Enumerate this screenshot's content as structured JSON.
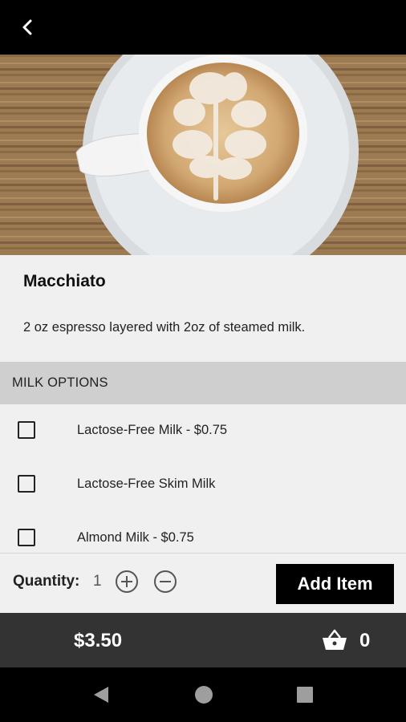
{
  "product": {
    "name": "Macchiato",
    "description": "2 oz espresso layered with 2oz of steamed milk."
  },
  "milk_options": {
    "header": "MILK OPTIONS",
    "items": [
      {
        "label": "Lactose-Free Milk - $0.75",
        "checked": false
      },
      {
        "label": "Lactose-Free Skim Milk",
        "checked": false
      },
      {
        "label": "Almond Milk - $0.75",
        "checked": false
      }
    ]
  },
  "quantity": {
    "label": "Quantity:",
    "value": "1"
  },
  "add_item_label": "Add Item",
  "cart": {
    "total": "$3.50",
    "count": "0"
  },
  "icons": {
    "back": "chevron-left-icon",
    "increment": "plus-circle-icon",
    "decrement": "minus-circle-icon",
    "cart": "shopping-basket-icon",
    "nav_back": "triangle-back-icon",
    "nav_home": "circle-home-icon",
    "nav_recents": "square-recents-icon"
  },
  "colors": {
    "top_bar": "#000000",
    "section_header": "#cfcfcf",
    "add_button": "#000000",
    "cart_bar": "#333333"
  }
}
